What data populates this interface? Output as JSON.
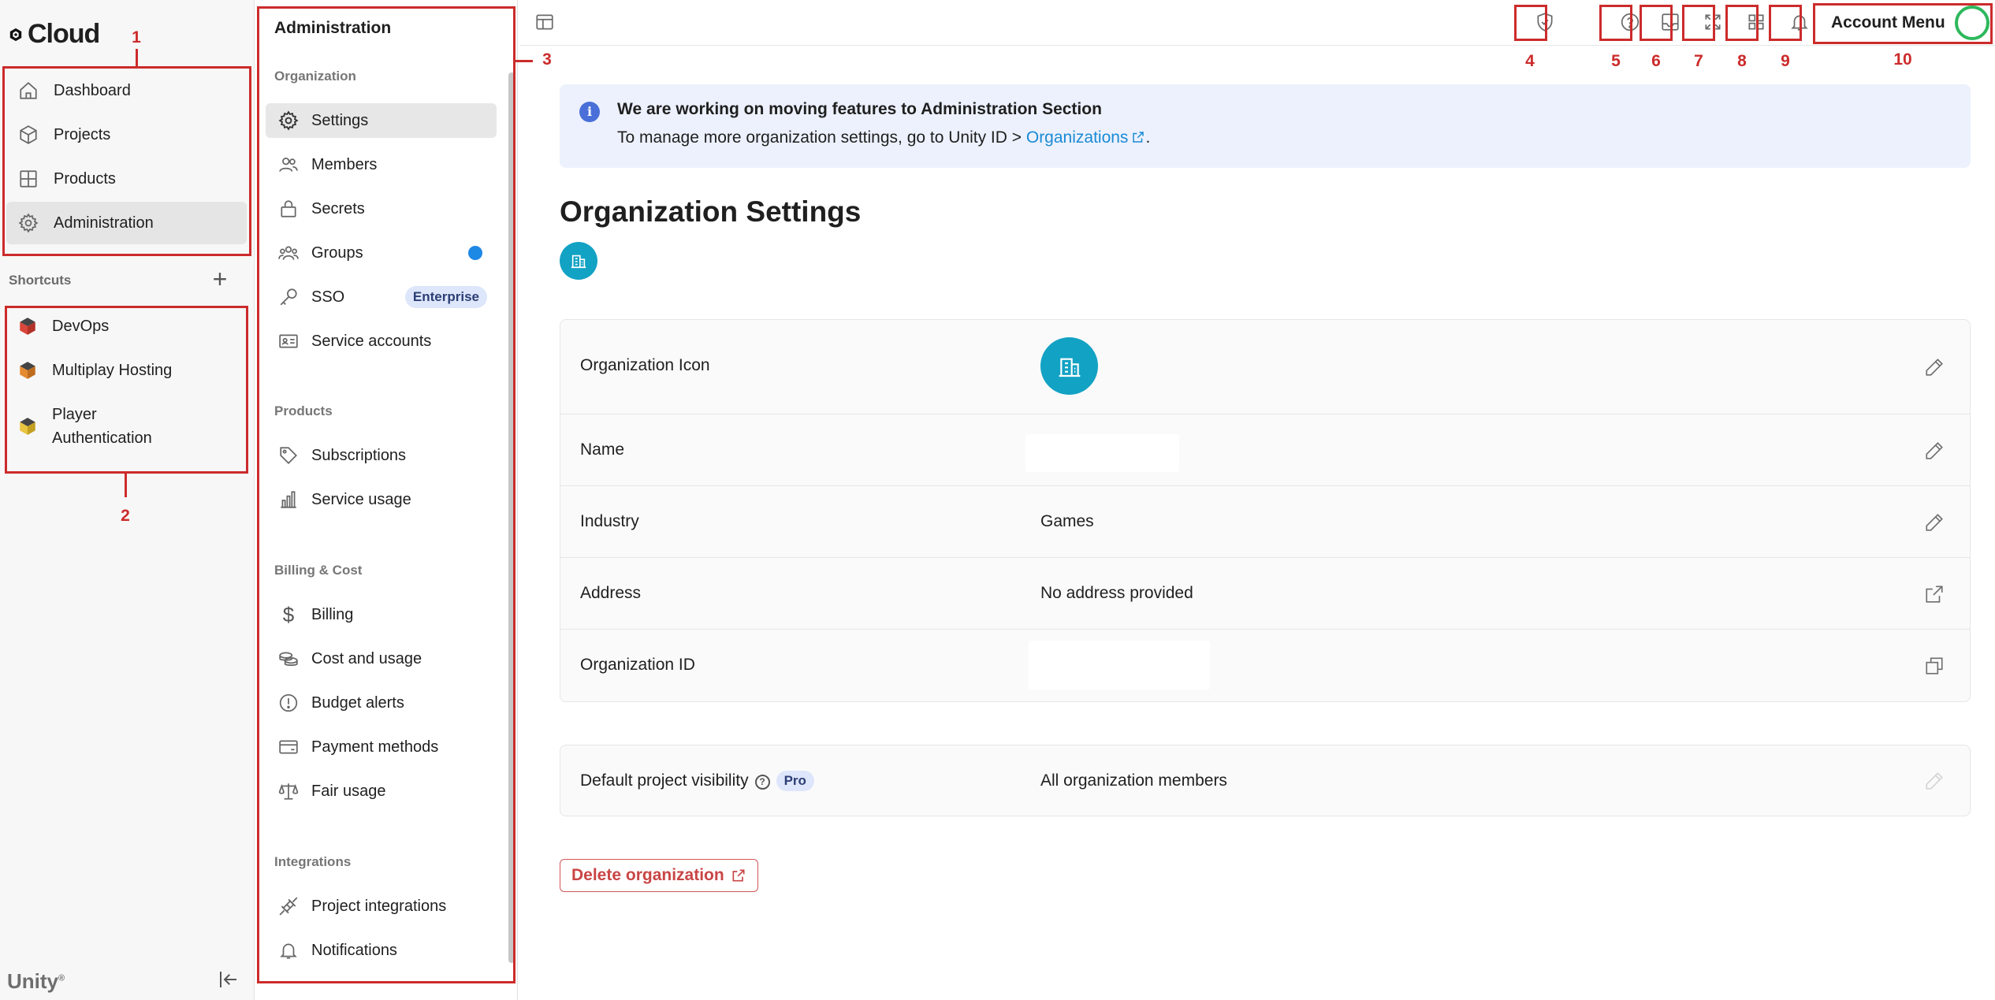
{
  "brand": {
    "logo_text": "Cloud",
    "footer_logo": "Unity"
  },
  "left_nav": {
    "items": [
      {
        "label": "Dashboard",
        "icon": "home-icon"
      },
      {
        "label": "Projects",
        "icon": "cube-icon"
      },
      {
        "label": "Products",
        "icon": "grid-icon"
      },
      {
        "label": "Administration",
        "icon": "gear-icon",
        "active": true
      }
    ],
    "shortcuts_title": "Shortcuts",
    "shortcuts": [
      {
        "label": "DevOps",
        "color": "#d9463b"
      },
      {
        "label": "Multiplay Hosting",
        "color": "#e58a2f"
      },
      {
        "label": "Player Authentication",
        "color": "#e8c441"
      }
    ]
  },
  "admin_panel": {
    "title": "Administration",
    "sections": [
      {
        "title": "Organization",
        "items": [
          "Settings",
          "Members",
          "Secrets",
          "Groups",
          "SSO",
          "Service accounts"
        ]
      },
      {
        "title": "Products",
        "items": [
          "Subscriptions",
          "Service usage"
        ]
      },
      {
        "title": "Billing & Cost",
        "items": [
          "Billing",
          "Cost and usage",
          "Budget alerts",
          "Payment methods",
          "Fair usage"
        ]
      },
      {
        "title": "Integrations",
        "items": [
          "Project integrations",
          "Notifications"
        ]
      }
    ],
    "sso_badge": "Enterprise"
  },
  "topbar": {
    "account_menu": "Account Menu"
  },
  "banner": {
    "title": "We are working on moving features to Administration Section",
    "text": "To manage more organization settings, go to Unity ID > ",
    "link": "Organizations",
    "suffix": "."
  },
  "main": {
    "title": "Organization Settings",
    "rows": [
      {
        "label": "Organization Icon",
        "value": ""
      },
      {
        "label": "Name",
        "value": ""
      },
      {
        "label": "Industry",
        "value": "Games"
      },
      {
        "label": "Address",
        "value": "No address provided"
      },
      {
        "label": "Organization ID",
        "value": ""
      }
    ],
    "visibility": {
      "label": "Default project visibility",
      "badge": "Pro",
      "value": "All organization members"
    },
    "delete_label": "Delete organization"
  },
  "annotations": [
    "1",
    "2",
    "3",
    "4",
    "5",
    "6",
    "7",
    "8",
    "9",
    "10"
  ],
  "colors": {
    "accent": "#1a8ad4",
    "org_icon": "#12a2c4",
    "annotation": "#cc2b2b",
    "danger": "#c94545"
  }
}
